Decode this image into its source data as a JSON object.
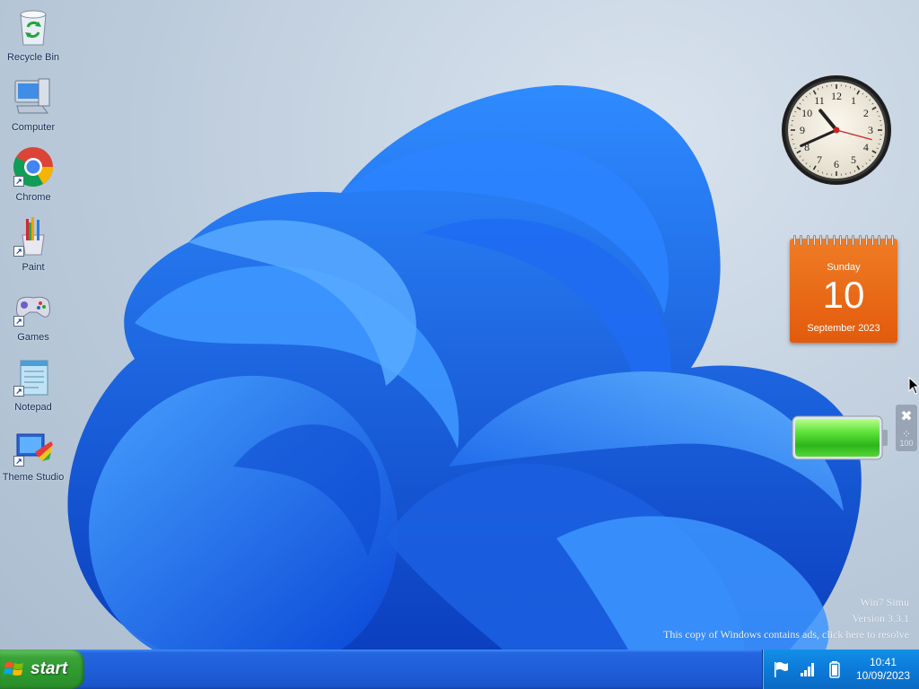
{
  "desktop": {
    "icons": [
      {
        "label": "Recycle Bin",
        "icon": "recycle-bin-icon",
        "shortcut": false
      },
      {
        "label": "Computer",
        "icon": "computer-icon",
        "shortcut": false
      },
      {
        "label": "Chrome",
        "icon": "chrome-icon",
        "shortcut": true
      },
      {
        "label": "Paint",
        "icon": "paint-icon",
        "shortcut": true
      },
      {
        "label": "Games",
        "icon": "gamepad-icon",
        "shortcut": true
      },
      {
        "label": "Notepad",
        "icon": "notepad-icon",
        "shortcut": true
      },
      {
        "label": "Theme Studio",
        "icon": "theme-studio-icon",
        "shortcut": true
      }
    ]
  },
  "gadgets": {
    "clock": {
      "hour": 10,
      "minute": 41,
      "numerals": [
        "12",
        "1",
        "2",
        "3",
        "4",
        "5",
        "6",
        "7",
        "8",
        "9",
        "10",
        "11"
      ]
    },
    "calendar": {
      "weekday": "Sunday",
      "day": "10",
      "month_year": "September 2023"
    },
    "battery": {
      "level_percent": 100,
      "overlay_text": "100"
    }
  },
  "watermark": {
    "line1": "Win7 Simu",
    "line2": "Version 3.3.1",
    "line3": "This copy of Windows contains ads, click here to resolve"
  },
  "taskbar": {
    "start_label": "start",
    "tray": {
      "icons": [
        "flag-icon",
        "signal-icon",
        "battery-icon"
      ],
      "time": "10:41",
      "date": "10/09/2023"
    }
  },
  "colors": {
    "taskbar_blue": "#1f5fd8",
    "start_green": "#2e9a2e",
    "calendar_orange": "#e8641a",
    "bloom_blue": "#1a6df0"
  }
}
